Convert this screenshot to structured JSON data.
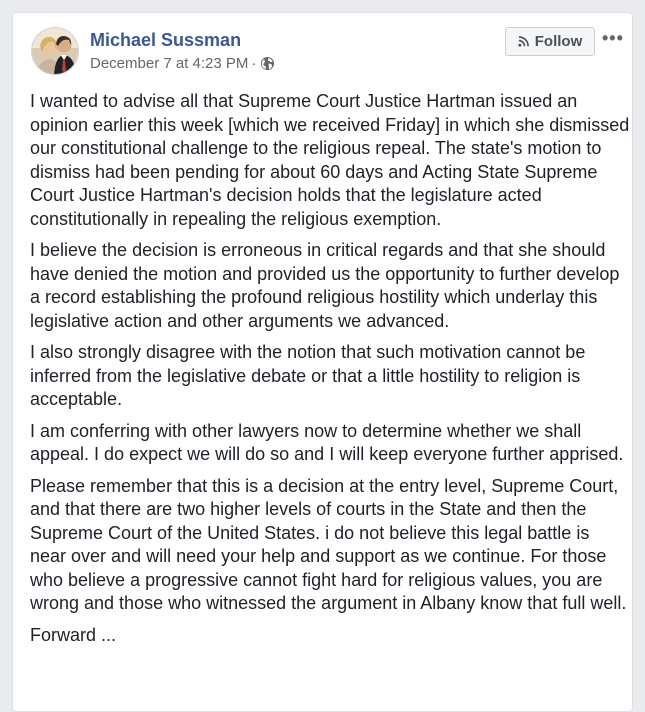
{
  "post": {
    "author": "Michael Sussman",
    "timestamp": "December 7 at 4:23 PM",
    "separator": "·",
    "audience_icon": "globe-icon",
    "follow_label": "Follow",
    "more_label": "•••",
    "paragraphs": [
      "I wanted to advise all that Supreme Court Justice Hartman issued an opinion earlier this week [which we received Friday] in which she dismissed our constitutional challenge to the religious repeal. The state's motion to dismiss had been pending for about 60 days and Acting State Supreme Court Justice Hartman's decision holds that the legislature acted constitutionally in repealing the religious exemption.",
      "I believe the decision is erroneous in critical regards and that she should have denied the motion and provided us the opportunity to further develop a record establishing the profound religious hostility which underlay this legislative action and other arguments we advanced.",
      "I also strongly disagree with the notion that such motivation cannot be inferred from the legislative debate or that a little hostility to religion is acceptable.",
      "I am conferring with other lawyers now to determine whether we shall appeal. I do expect we will do so and I will keep everyone further apprised.",
      "Please remember that this is a decision at the entry level, Supreme Court, and that there are two higher levels of courts in the State and then the Supreme Court of the United States. i do not believe this legal battle is near over and will need your help and support as we continue. For those who believe a progressive cannot fight hard for religious values, you are wrong and those who witnessed the argument in Albany know that full well.",
      "Forward ..."
    ]
  },
  "colors": {
    "author_link": "#385898",
    "meta_text": "#616770",
    "body_text": "#1d2129",
    "page_bg": "#e9ebee"
  }
}
